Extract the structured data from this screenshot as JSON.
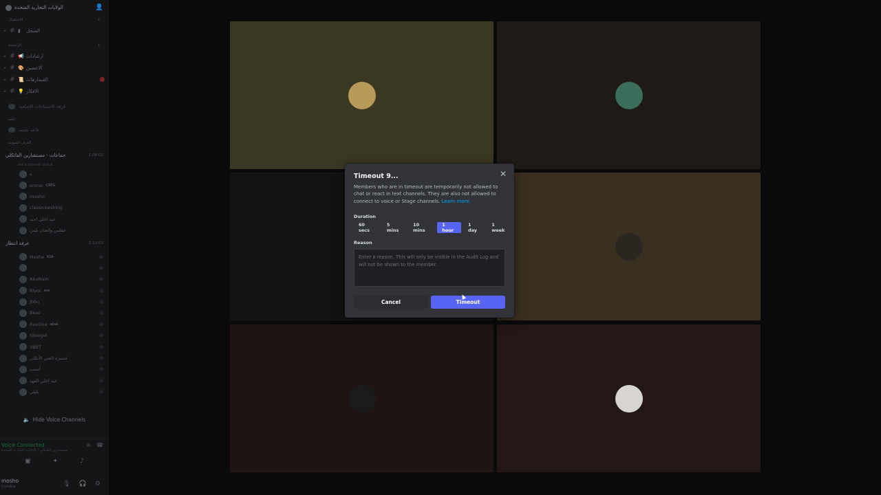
{
  "sidebar": {
    "server_name": "الولايات التجارية المتحدة",
    "cat_1": "الاستقبال",
    "channel_1": "السجل",
    "cat_2": "الرئيسية",
    "channels": [
      {
        "emoji": "📢",
        "name": "ارشادات"
      },
      {
        "emoji": "🎨",
        "name": "الاعضين"
      },
      {
        "emoji": "📜",
        "name": "القيمارهات"
      },
      {
        "emoji": "💡",
        "name": "الافكار"
      }
    ],
    "plain_1": "غرفة الاجتماعات الإضافية",
    "cat_3": "عامه",
    "plain_2": "قاعه عسبه",
    "cat_4": "الغرف الصوتيه",
    "voice_channel_1": {
      "name": "جماعات - مستشارين الفاتكلي",
      "time": "1:08:02",
      "topic": "set a channel status"
    },
    "voice_users_1": [
      {
        "name": "ه",
        "tag": ""
      },
      {
        "name": "omrar",
        "tag": "CRTG"
      },
      {
        "name": "mosho",
        "tag": ""
      },
      {
        "name": "classicswsking",
        "tag": ""
      },
      {
        "name": "عبد اعلي اجيد",
        "tag": ""
      },
      {
        "name": "حقلس والعنان بلس",
        "tag": ""
      }
    ],
    "voice_channel_2": {
      "name": "غرفة انتظار",
      "time": "2:12:03"
    },
    "voice_users_2": [
      {
        "name": "Moshe",
        "tag": "KSA"
      },
      {
        "name": "",
        "tag": ""
      },
      {
        "name": "AbuNam",
        "tag": ""
      },
      {
        "name": "Riyot",
        "tag": "see"
      },
      {
        "name": "Jbbu",
        "tag": ""
      },
      {
        "name": "Bexo",
        "tag": ""
      },
      {
        "name": "RaeOne",
        "tag": "abak"
      },
      {
        "name": "Sbsegel",
        "tag": ""
      },
      {
        "name": "3BBT",
        "tag": ""
      },
      {
        "name": "عسبرة الفتي الأنكلي",
        "tag": ""
      },
      {
        "name": "أنسب",
        "tag": ""
      },
      {
        "name": "عبد اعلي الفهد",
        "tag": ""
      },
      {
        "name": "بلبلي",
        "tag": ""
      }
    ],
    "hide_voice_label": "Hide Voice Channels",
    "voice_connected": "Voice Connected",
    "voice_connected_sub": "مستشارين الفاتكلي / الولايات التجارية المتحدة",
    "user": {
      "name": "mosho",
      "status": "Invisible"
    }
  },
  "tiles": [
    {
      "bg": "#3a3722",
      "avatar": "#b89a5a"
    },
    {
      "bg": "#1e1a18",
      "avatar": "#3a6d5a"
    },
    {
      "bg": "#111112",
      "avatar": "#111112"
    },
    {
      "bg": "#3a3021",
      "avatar": "#2c2620"
    },
    {
      "bg": "#1f1414",
      "avatar": "#1a1a1a"
    },
    {
      "bg": "#231715",
      "avatar": "#d8d4d0"
    }
  ],
  "modal": {
    "title": "Timeout 9...",
    "description": "Members who are in timeout are temporarily not allowed to chat or react in text channels. They are also not allowed to connect to voice or Stage channels.",
    "learn_more": "Learn more.",
    "duration_label": "Duration",
    "durations": [
      "60 secs",
      "5 mins",
      "10 mins",
      "1 hour",
      "1 day",
      "1 week"
    ],
    "selected_duration": "1 hour",
    "reason_label": "Reason",
    "reason_placeholder": "Enter a reason. This will only be visible in the Audit Log and will not be shown to the member.",
    "cancel_label": "Cancel",
    "timeout_label": "Timeout"
  },
  "colors": {
    "accent": "#5865f2",
    "link": "#00a8fc",
    "modal_bg": "#313338"
  }
}
